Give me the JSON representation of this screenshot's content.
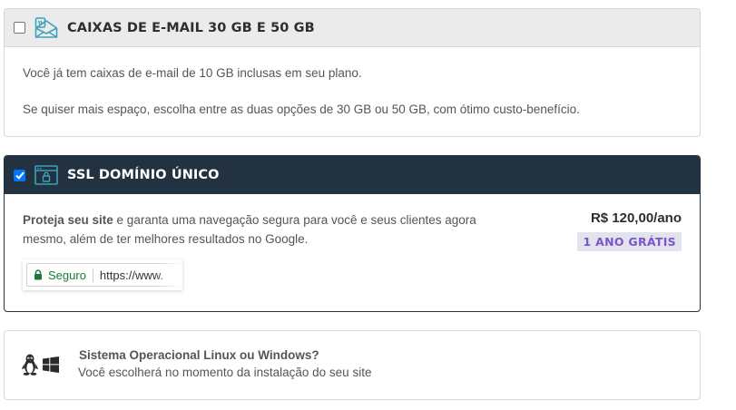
{
  "email_box": {
    "title": "CAIXAS DE E-MAIL 30 GB E 50 GB",
    "checked": false,
    "icon": "email-boxes-icon",
    "line1": "Você já tem caixas de e-mail de 10 GB inclusas em seu plano.",
    "line2": "Se quiser mais espaço, escolha entre as duas opções de 30 GB ou 50 GB, com ótimo custo-benefício."
  },
  "ssl": {
    "title": "SSL DOMÍNIO ÚNICO",
    "checked": true,
    "icon": "ssl-browser-lock-icon",
    "bold_lead": "Proteja seu site",
    "line1_rest": " e garanta uma navegação segura para você e seus clientes agora",
    "line2": "mesmo, além de ter melhores resultados no Google.",
    "price": "R$ 120,00/ano",
    "badge": "1 ANO GRÁTIS",
    "secure_label": "Seguro",
    "url": "https://www."
  },
  "os": {
    "title": "Sistema Operacional Linux ou Windows?",
    "subtitle": "Você escolherá no momento da instalação do seu site",
    "icons": [
      "linux-tux-icon",
      "windows-icon"
    ]
  },
  "colors": {
    "dark_header": "#233240",
    "accent_teal": "#3aa3b8",
    "badge_text": "#7b56c9",
    "badge_bg": "#e3e3ee",
    "checkbox_blue": "#0075ff",
    "secure_green": "#1a7a3a"
  }
}
